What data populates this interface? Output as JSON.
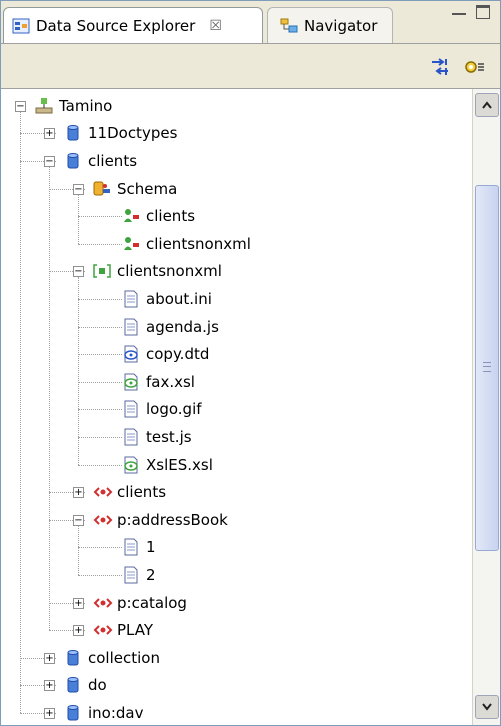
{
  "tabs": [
    {
      "label": "Data Source Explorer",
      "close": "☒",
      "active": true
    },
    {
      "label": "Navigator",
      "active": false
    }
  ],
  "toolbar": {
    "icons": [
      "link-with-editor-icon",
      "view-menu-icon"
    ]
  },
  "tree": {
    "nodes": [
      {
        "label": "Tamino",
        "level": 0,
        "icon": "server-icon",
        "expanded": true
      },
      {
        "label": "11Doctypes",
        "level": 1,
        "icon": "database-icon",
        "expanded": false
      },
      {
        "label": "clients",
        "level": 1,
        "icon": "database-icon",
        "expanded": true
      },
      {
        "label": "Schema",
        "level": 2,
        "icon": "schema-folder-icon",
        "expanded": true
      },
      {
        "label": "clients",
        "level": 3,
        "icon": "schema-icon"
      },
      {
        "label": "clientsnonxml",
        "level": 3,
        "icon": "schema-icon"
      },
      {
        "label": "clientsnonxml",
        "level": 2,
        "icon": "collection-icon",
        "expanded": true
      },
      {
        "label": "about.ini",
        "level": 3,
        "icon": "file-icon"
      },
      {
        "label": "agenda.js",
        "level": 3,
        "icon": "file-icon"
      },
      {
        "label": "copy.dtd",
        "level": 3,
        "icon": "xml-file-icon"
      },
      {
        "label": "fax.xsl",
        "level": 3,
        "icon": "xsl-file-icon"
      },
      {
        "label": "logo.gif",
        "level": 3,
        "icon": "file-icon"
      },
      {
        "label": "test.js",
        "level": 3,
        "icon": "file-icon"
      },
      {
        "label": "XslES.xsl",
        "level": 3,
        "icon": "xsl-file-icon"
      },
      {
        "label": "clients",
        "level": 2,
        "icon": "doctype-icon",
        "expanded": false
      },
      {
        "label": "p:addressBook",
        "level": 2,
        "icon": "doctype-icon",
        "expanded": true
      },
      {
        "label": "1",
        "level": 3,
        "icon": "file-icon"
      },
      {
        "label": "2",
        "level": 3,
        "icon": "file-icon"
      },
      {
        "label": "p:catalog",
        "level": 2,
        "icon": "doctype-icon",
        "expanded": false
      },
      {
        "label": "PLAY",
        "level": 2,
        "icon": "doctype-icon",
        "expanded": false
      },
      {
        "label": "collection",
        "level": 1,
        "icon": "database-icon",
        "expanded": false
      },
      {
        "label": "do",
        "level": 1,
        "icon": "database-icon",
        "expanded": false
      },
      {
        "label": "ino:dav",
        "level": 1,
        "icon": "database-icon",
        "expanded": false
      }
    ]
  },
  "colors": {
    "accent": "#3163c3",
    "db_blue": "#4a7fd8",
    "doctype_red": "#d23030",
    "xsl_green": "#3fa33f"
  }
}
